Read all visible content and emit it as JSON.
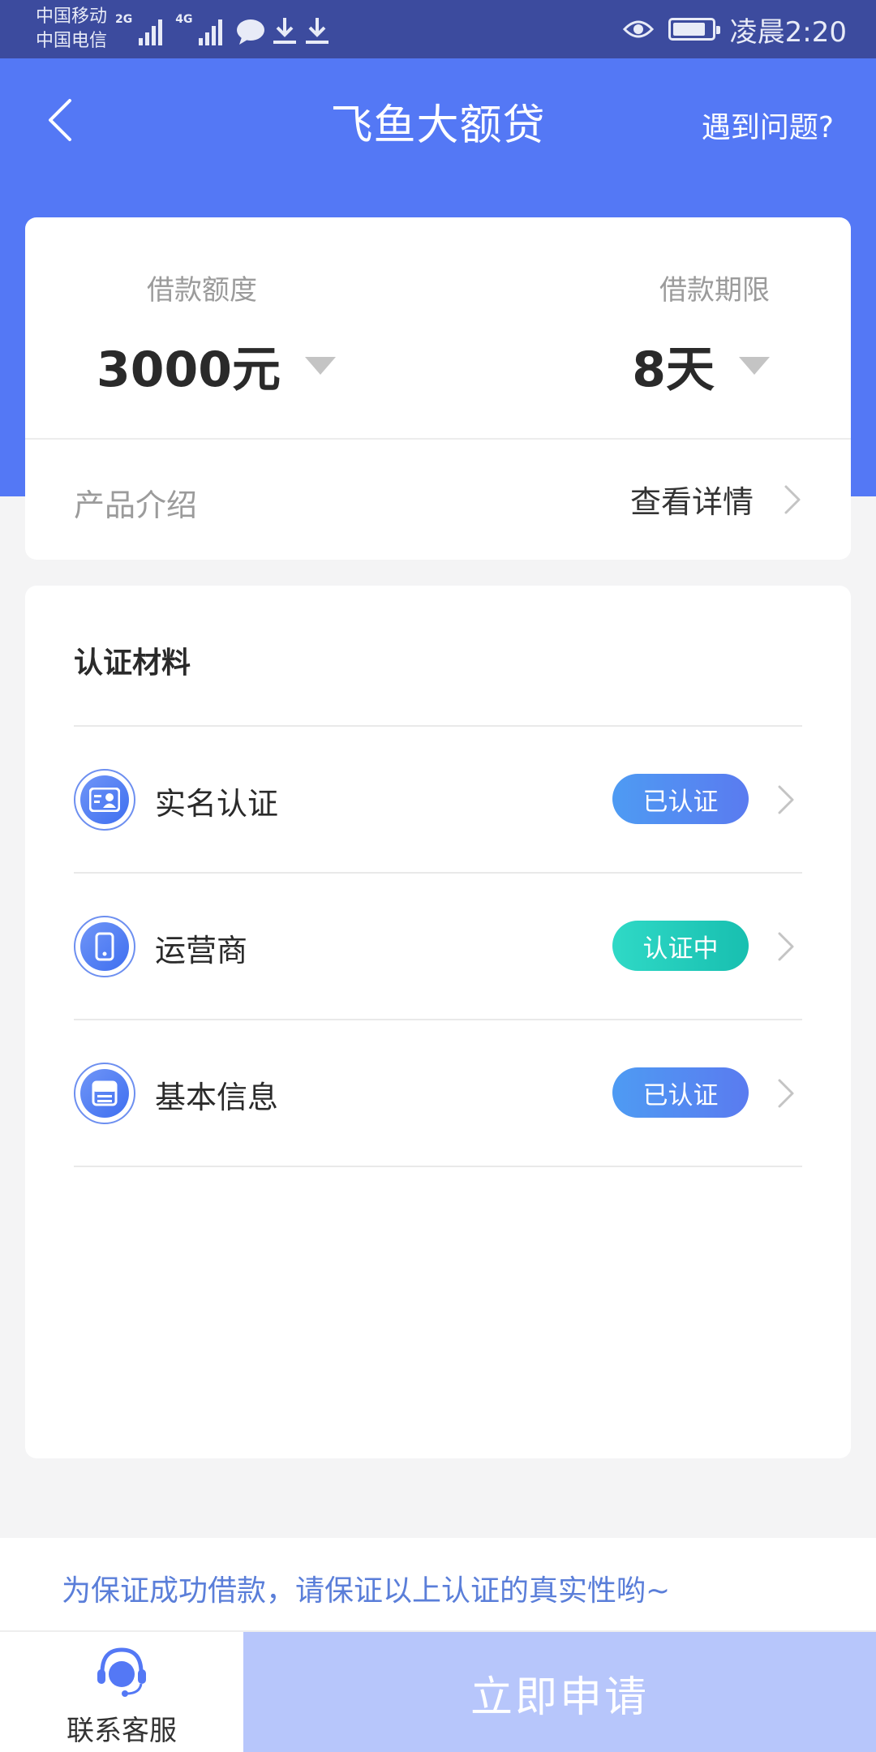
{
  "status_bar": {
    "carrier_1": "中国移动",
    "carrier_2": "中国电信",
    "net_1": "2G",
    "net_2": "4G",
    "time": "凌晨2:20",
    "battery_level": 0.85
  },
  "header": {
    "title": "飞鱼大额贷",
    "help": "遇到问题?",
    "color": "#5478f5"
  },
  "loan": {
    "amount_label": "借款额度",
    "amount_value": "3000元",
    "term_label": "借款期限",
    "term_value": "8天",
    "product_label": "产品介绍",
    "detail_link": "查看详情"
  },
  "certification": {
    "title": "认证材料",
    "items": [
      {
        "label": "实名认证",
        "status": "已认证",
        "icon": "id-card-icon"
      },
      {
        "label": "运营商",
        "status": "认证中",
        "icon": "phone-icon"
      },
      {
        "label": "基本信息",
        "status": "已认证",
        "icon": "document-icon"
      }
    ]
  },
  "notice": "为保证成功借款，请保证以上认证的真实性哟~",
  "bottom": {
    "service_label": "联系客服",
    "apply_label": "立即申请"
  }
}
